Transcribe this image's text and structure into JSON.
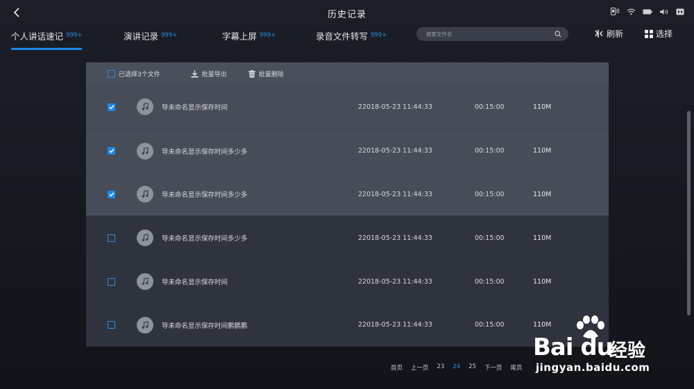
{
  "header": {
    "title": "历史记录",
    "battery_count": "8"
  },
  "tabs": [
    {
      "label": "个人讲话速记",
      "count": "999+"
    },
    {
      "label": "演讲记录",
      "count": "999+"
    },
    {
      "label": "字幕上屏",
      "count": "999+"
    },
    {
      "label": "录音文件转写",
      "count": "999+"
    }
  ],
  "search": {
    "placeholder": "搜索文件名"
  },
  "actions": {
    "refresh": "刷新",
    "select": "选择"
  },
  "toolbar": {
    "selected_label": "已选择3个文件",
    "export_label": "批量导出",
    "delete_label": "批量删除"
  },
  "rows": [
    {
      "checked": true,
      "name": "导未命名显示保存时间",
      "date": "22018-05-23 11:44:33",
      "duration": "00:15:00",
      "size": "110M"
    },
    {
      "checked": true,
      "name": "导未命名显示保存时间多少多",
      "date": "22018-05-23 11:44:33",
      "duration": "00:15:00",
      "size": "110M"
    },
    {
      "checked": true,
      "name": "导未命名显示保存时间多少多",
      "date": "22018-05-23 11:44:33",
      "duration": "00:15:00",
      "size": "110M"
    },
    {
      "checked": false,
      "name": "导未命名显示保存时间多少多",
      "date": "22018-05-23 11:44:33",
      "duration": "00:15:00",
      "size": "110M"
    },
    {
      "checked": false,
      "name": "导未命名显示保存时间",
      "date": "22018-05-23 11:44:33",
      "duration": "00:15:00",
      "size": "110M"
    },
    {
      "checked": false,
      "name": "导未命名显示保存时间鹏鹏鹏",
      "date": "22018-05-23 11:44:33",
      "duration": "00:15:00",
      "size": "110M"
    }
  ],
  "pagination": {
    "first": "首页",
    "prev": "上一页",
    "pages": [
      "23",
      "24",
      "25"
    ],
    "current": "24",
    "next": "下一页",
    "last": "尾页"
  },
  "watermark": {
    "logo": "Bai du",
    "brand": "经验",
    "url": "jingyan.baidu.com"
  },
  "colors": {
    "accent": "#1e88e5",
    "background": "#1b1e27",
    "panel": "#3d4250"
  }
}
